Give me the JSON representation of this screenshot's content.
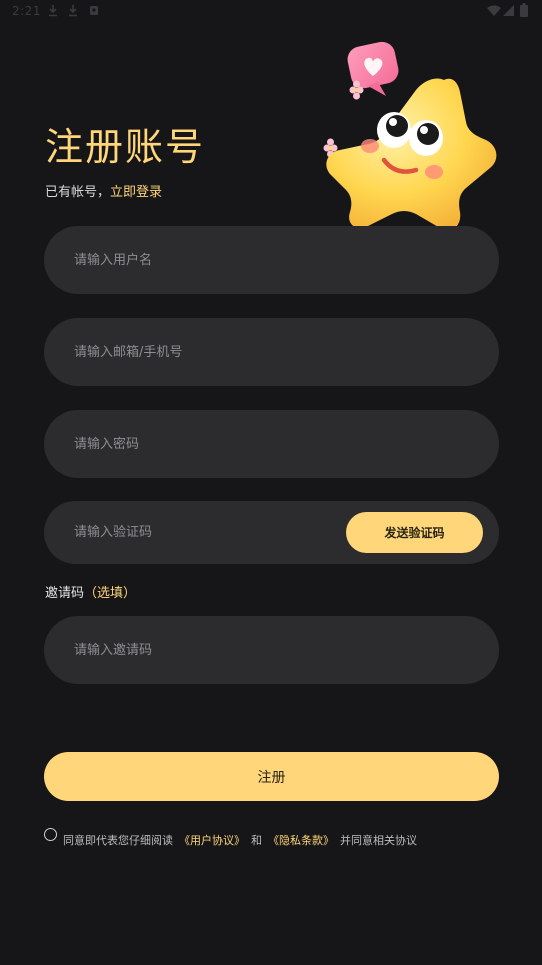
{
  "status_bar": {
    "time": "2:21",
    "icons": [
      "download-icon",
      "download-icon",
      "storage-icon",
      "wifi-icon",
      "signal-icon",
      "battery-icon"
    ]
  },
  "header": {
    "title": "注册账号",
    "login_prompt": "已有帐号，",
    "login_link": "立即登录"
  },
  "mascot": {
    "icon": "star-mascot-illustration"
  },
  "form": {
    "username_placeholder": "请输入用户名",
    "account_placeholder": "请输入邮箱/手机号",
    "password_placeholder": "请输入密码",
    "code_placeholder": "请输入验证码",
    "send_code_label": "发送验证码",
    "invite_label": "邀请码",
    "invite_optional": "（选填）",
    "invite_placeholder": "请输入邀请码",
    "submit_label": "注册"
  },
  "agreement": {
    "checked": false,
    "prefix": "同意即代表您仔细阅读",
    "user_agreement": "《用户协议》",
    "and": "和",
    "privacy_policy": "《隐私条款》",
    "suffix": "并同意相关协议"
  },
  "colors": {
    "background": "#161618",
    "accent": "#FFD679",
    "field_bg": "#2C2C2E",
    "placeholder": "#8E8E93"
  }
}
